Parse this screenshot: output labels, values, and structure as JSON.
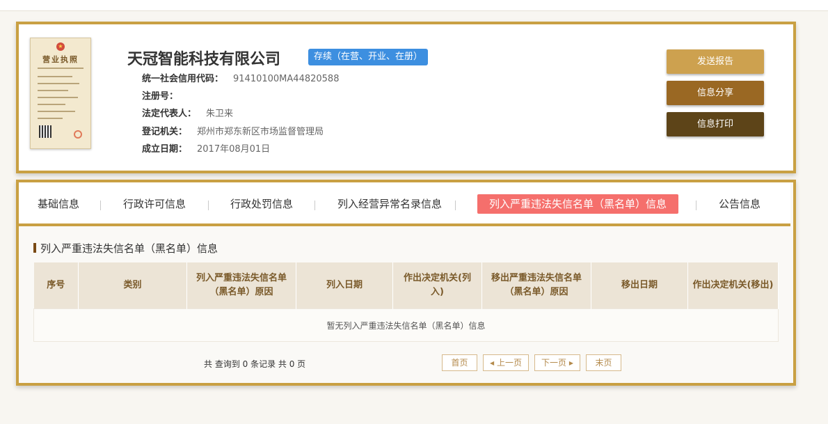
{
  "company": {
    "name": "天冠智能科技有限公司",
    "status": "存续（在营、开业、在册）",
    "license_label": "营业执照",
    "fields": [
      {
        "label": "统一社会信用代码：",
        "value": "91410100MA44820588"
      },
      {
        "label": "注册号：",
        "value": ""
      },
      {
        "label": "法定代表人：",
        "value": "朱卫来"
      },
      {
        "label": "登记机关：",
        "value": "郑州市郑东新区市场监督管理局"
      },
      {
        "label": "成立日期：",
        "value": "2017年08月01日"
      }
    ]
  },
  "actions": {
    "send_report": "发送报告",
    "share": "信息分享",
    "print": "信息打印"
  },
  "tabs": [
    "基础信息",
    "行政许可信息",
    "行政处罚信息",
    "列入经营异常名录信息",
    "列入严重违法失信名单（黑名单）信息",
    "公告信息"
  ],
  "section": {
    "title": "列入严重违法失信名单（黑名单）信息",
    "columns": [
      "序号",
      "类别",
      "列入严重违法失信名单（黑名单）原因",
      "列入日期",
      "作出决定机关(列入)",
      "移出严重违法失信名单（黑名单）原因",
      "移出日期",
      "作出决定机关(移出)"
    ],
    "empty": "暂无列入严重违法失信名单（黑名单）信息"
  },
  "pagination": {
    "summary": "共 查询到 0 条记录 共 0 页",
    "first": "首页",
    "prev": "上一页",
    "next": "下一页",
    "last": "末页"
  },
  "colors": {
    "accent": "#c9a043",
    "active_tab": "#f56f6c",
    "status_badge": "#3d8fe0"
  }
}
